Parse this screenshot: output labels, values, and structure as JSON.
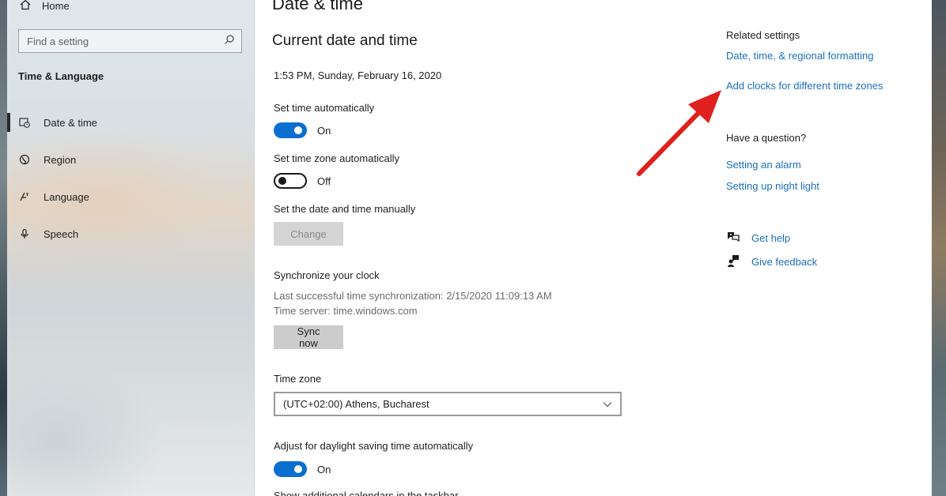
{
  "sidebar": {
    "home_label": "Home",
    "search_placeholder": "Find a setting",
    "section_title": "Time & Language",
    "items": [
      {
        "label": "Date & time",
        "icon": "calendar-clock-icon",
        "active": true
      },
      {
        "label": "Region",
        "icon": "globe-icon",
        "active": false
      },
      {
        "label": "Language",
        "icon": "language-icon",
        "active": false
      },
      {
        "label": "Speech",
        "icon": "microphone-icon",
        "active": false
      }
    ]
  },
  "main": {
    "page_title": "Date & time",
    "sub_title": "Current date and time",
    "current_datetime": "1:53 PM, Sunday, February 16, 2020",
    "set_time_auto": {
      "label": "Set time automatically",
      "state": "On"
    },
    "set_timezone_auto": {
      "label": "Set time zone automatically",
      "state": "Off"
    },
    "manual": {
      "label": "Set the date and time manually",
      "button": "Change"
    },
    "sync": {
      "title": "Synchronize your clock",
      "last_sync": "Last successful time synchronization: 2/15/2020 11:09:13 AM",
      "server": "Time server: time.windows.com",
      "button": "Sync now"
    },
    "timezone": {
      "label": "Time zone",
      "value": "(UTC+02:00) Athens, Bucharest"
    },
    "dst": {
      "label": "Adjust for daylight saving time automatically",
      "state": "On"
    },
    "cutoff_label": "Show additional calendars in the taskbar"
  },
  "right": {
    "related_title": "Related settings",
    "related_links": [
      "Date, time, & regional formatting",
      "Add clocks for different time zones"
    ],
    "question_title": "Have a question?",
    "question_links": [
      "Setting an alarm",
      "Setting up night light"
    ],
    "help_label": "Get help",
    "feedback_label": "Give feedback"
  },
  "colors": {
    "accent": "#0a6fd0",
    "link": "#1a6fc0",
    "arrow": "#e0201c"
  }
}
